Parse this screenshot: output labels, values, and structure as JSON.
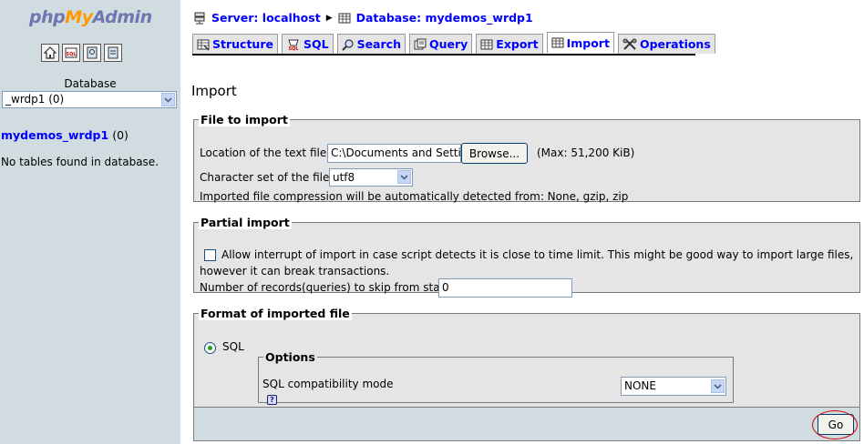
{
  "left": {
    "logo": {
      "php": "php",
      "my": "My",
      "admin": "Admin"
    },
    "icons": [
      "home-icon",
      "sql-query-window-icon",
      "documentation-icon",
      "mysql-documentation-icon"
    ],
    "database_label": "Database",
    "database_select": "_wrdp1 (0)",
    "db_name": "mydemos_wrdp1",
    "db_count": "(0)",
    "no_tables": "No tables found in database."
  },
  "breadcrumb": {
    "server": "Server: localhost",
    "database": "Database: mydemos_wrdp1"
  },
  "tabs": [
    {
      "label": "Structure",
      "icon": "structure-icon"
    },
    {
      "label": "SQL",
      "icon": "sql-icon"
    },
    {
      "label": "Search",
      "icon": "search-icon"
    },
    {
      "label": "Query",
      "icon": "query-icon"
    },
    {
      "label": "Export",
      "icon": "export-icon"
    },
    {
      "label": "Import",
      "icon": "import-icon",
      "active": true
    },
    {
      "label": "Operations",
      "icon": "operations-icon"
    }
  ],
  "page_title": "Import",
  "file_to_import": {
    "legend": "File to import",
    "location_label": "Location of the text file",
    "location_value": "C:\\Documents and Settin",
    "browse_label": "Browse...",
    "max_size": "(Max: 51,200 KiB)",
    "charset_label": "Character set of the file:",
    "charset_value": "utf8",
    "compression_note": "Imported file compression will be automatically detected from: None, gzip, zip"
  },
  "partial_import": {
    "legend": "Partial import",
    "allow_interrupt_line1": "Allow interrupt of import in case script detects it is close to time limit. This might be good way to import large files,",
    "allow_interrupt_line2": "however it can break transactions.",
    "allow_interrupt_checked": false,
    "skip_label": "Number of records(queries) to skip from start",
    "skip_value": "0"
  },
  "format": {
    "legend": "Format of imported file",
    "sql_label": "SQL",
    "sql_selected": true,
    "options_legend": "Options",
    "compat_label": "SQL compatibility mode",
    "compat_value": "NONE"
  },
  "go_label": "Go",
  "colors": {
    "left_bg": "#d0dce0",
    "fieldset_bg": "#e5e5e5",
    "link": "#0000ff",
    "highlight_ring": "#d40000"
  }
}
